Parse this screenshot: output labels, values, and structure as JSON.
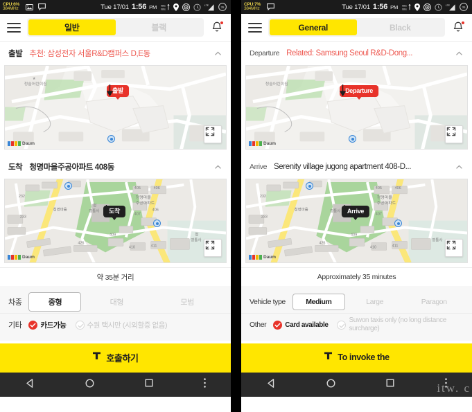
{
  "statusbar": {
    "cpu_line1": "CPU:6%",
    "cpu_line2": "384MHz",
    "cpu_line1_right": "CPU:7%",
    "cpu_line2_right": "384MHz",
    "date": "Tue 17/01",
    "time": "1:56",
    "ampm": "PM",
    "icons_left": [
      "image-icon",
      "chat-icon"
    ],
    "icons_right": [
      "data-transfer-icon",
      "location-pin-icon",
      "target-icon",
      "alarm-clock-icon",
      "lte-signal-icon",
      "battery-icon"
    ],
    "battery_level": "35"
  },
  "ko": {
    "appbar": {
      "menu": "menu-icon",
      "tab_general": "일반",
      "tab_black": "블랙",
      "bell": "notification-bell-icon"
    },
    "departure": {
      "label": "출발",
      "value": "추천: 삼성전자 서울R&D캠퍼스 D,E동",
      "pin": "출발",
      "map_labels": [
        "청솔어린이집"
      ],
      "logo": "Daum"
    },
    "arrive": {
      "label": "도착",
      "value": "청명마을주공아파트 408동",
      "pin": "도착",
      "map_labels": [
        "청명마을",
        "주공아파트",
        "청명마을",
        "영통사",
        "영통사",
        "405",
        "406",
        "407",
        "408",
        "409",
        "410",
        "411",
        "425",
        "232",
        "233"
      ],
      "logo": "Daum"
    },
    "distance": "약 35분 거리",
    "options": {
      "vehicle_label": "차종",
      "vehicle_types": [
        "중형",
        "대형",
        "모범"
      ],
      "vehicle_selected": "중형",
      "other_label": "기타",
      "check_on": "카드가능",
      "check_off": "수원 택시만 (시외할증 없음)"
    },
    "cta": {
      "icon": "taxi-t-icon",
      "label": "호출하기"
    }
  },
  "en": {
    "appbar": {
      "menu": "menu-icon",
      "tab_general": "General",
      "tab_black": "Black",
      "bell": "notification-bell-icon"
    },
    "departure": {
      "label": "Departure",
      "value": "Related: Samsung Seoul R&D-Dong...",
      "pin": "Departure",
      "logo": "Daum"
    },
    "arrive": {
      "label": "Arrive",
      "value": "Serenity village jugong apartment 408-D...",
      "pin": "Arrive",
      "logo": "Daum"
    },
    "distance": "Approximately 35 minutes",
    "options": {
      "vehicle_label": "Vehicle type",
      "vehicle_types": [
        "Medium",
        "Large",
        "Paragon"
      ],
      "vehicle_selected": "Medium",
      "other_label": "Other",
      "check_on": "Card available",
      "check_off": "Suwon taxis only (no long distance surcharge)"
    },
    "cta": {
      "icon": "taxi-t-icon",
      "label": "To invoke the"
    }
  },
  "navbar": {
    "back": "back-triangle-icon",
    "home": "home-circle-icon",
    "recents": "recents-square-icon",
    "overflow": "overflow-dots-icon"
  },
  "watermark": "itw. c",
  "colors": {
    "accent_yellow": "#ffe600",
    "red": "#e8332a",
    "link_red": "#ee5a52",
    "dark": "#1f1f1f",
    "panel_gray": "#f7f7f7"
  }
}
